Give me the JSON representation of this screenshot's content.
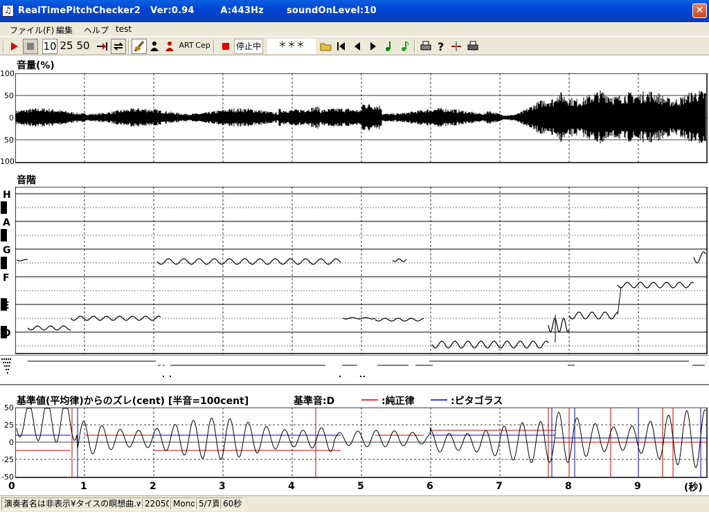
{
  "titlebar": {
    "title": "RealTimePitchChecker2   Ver:0.94        A:443Hz       soundOnLevel:10",
    "close_glyph": "✕"
  },
  "menu": [
    "ファイル(F)",
    "編集",
    "ヘルプ",
    "test"
  ],
  "toolbar": {
    "zoom_options": [
      "10",
      "25",
      "50"
    ],
    "art_label": "ART",
    "cep_label": "Cep",
    "status": "停止中",
    "current_note": "＊＊＊",
    "icons": [
      "play-icon",
      "stop-icon",
      "jump-to-end-icon",
      "loop-icon",
      "violin-icon",
      "metronome-icon",
      "singer-icon",
      "record-icon",
      "open-folder-icon",
      "skip-start-icon",
      "step-back-icon",
      "step-forward-icon",
      "note-icon",
      "note-green-icon",
      "print-icon",
      "help-icon",
      "marker-icon",
      "print-preview-icon"
    ]
  },
  "volume_panel": {
    "label": "音量(%)",
    "yticks": [
      "100",
      "50",
      "0",
      "50",
      "100"
    ]
  },
  "scale_panel": {
    "label": "音階",
    "notes": [
      "H",
      "A",
      "G",
      "F",
      "E",
      "D",
      "C"
    ]
  },
  "deviation_panel": {
    "label": "基準値(平均律)からのズレ(cent) [半音=100cent]",
    "base_note": "基準音:D",
    "legend_just": ":純正律",
    "legend_pythagorean": ":ピタゴラス",
    "yticks": [
      "50",
      "25",
      "0",
      "-25",
      "-50"
    ],
    "just_color": "#cc0000",
    "pythagorean_color": "#0000cc"
  },
  "xaxis": {
    "ticks": [
      "0",
      "1",
      "2",
      "3",
      "4",
      "5",
      "6",
      "7",
      "8",
      "9"
    ],
    "unit": "(秒)"
  },
  "statusbar": {
    "file": "演奏者名は非表示¥タイスの瞑想曲.wav",
    "rate": "22050",
    "channels": "Mono",
    "page": "5/7頁",
    "duration": "60秒"
  }
}
